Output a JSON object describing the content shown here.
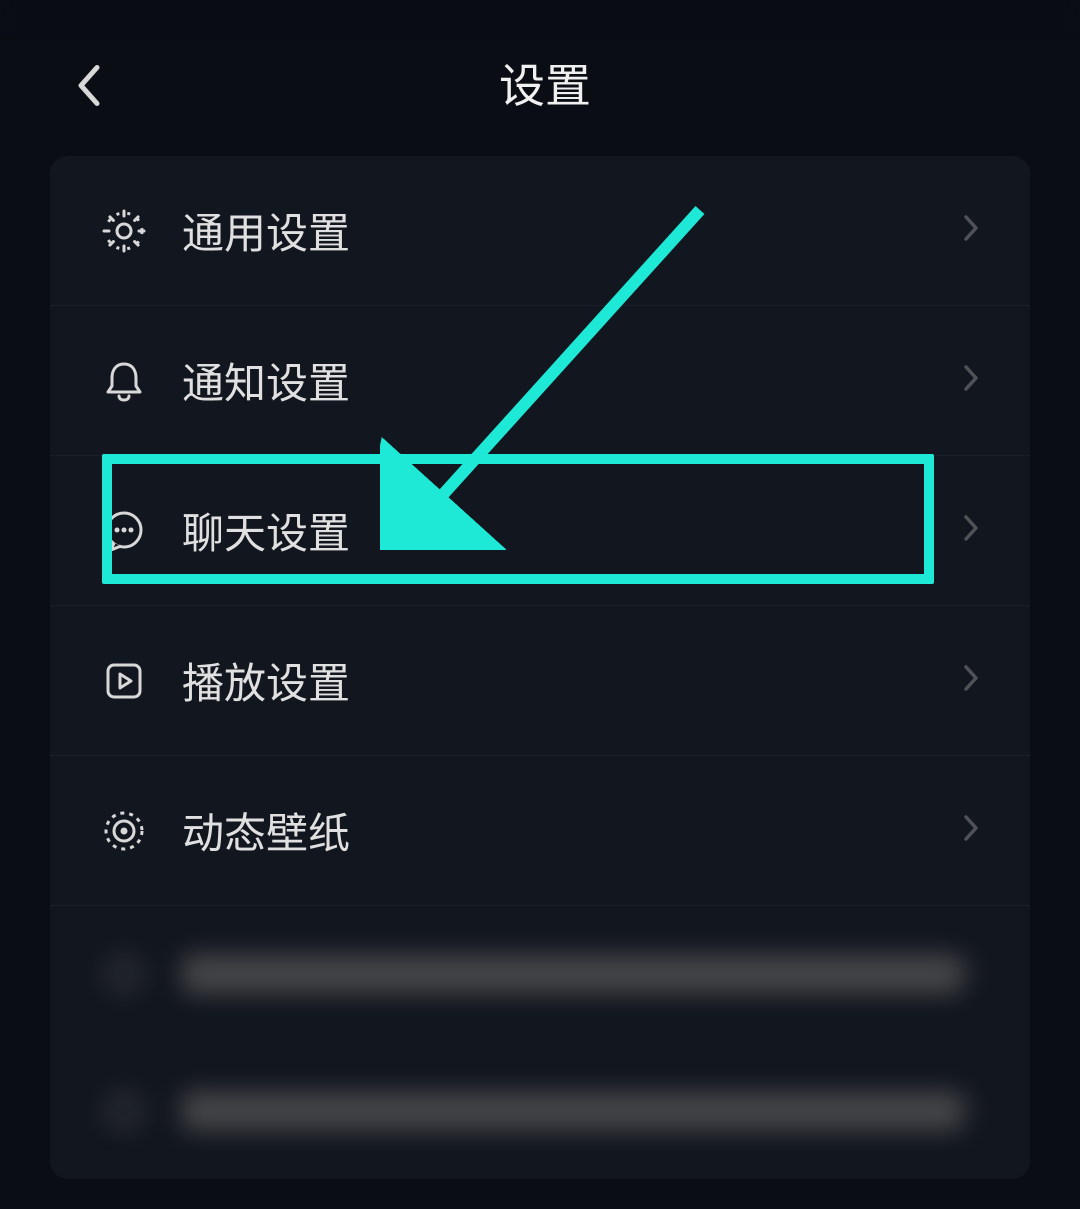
{
  "header": {
    "title": "设置"
  },
  "items": [
    {
      "label": "通用设置",
      "icon": "gear-icon"
    },
    {
      "label": "通知设置",
      "icon": "bell-icon"
    },
    {
      "label": "聊天设置",
      "icon": "chat-icon"
    },
    {
      "label": "播放设置",
      "icon": "play-icon"
    },
    {
      "label": "动态壁纸",
      "icon": "target-icon"
    }
  ],
  "annotation": {
    "highlight_color": "#1de9d6"
  }
}
